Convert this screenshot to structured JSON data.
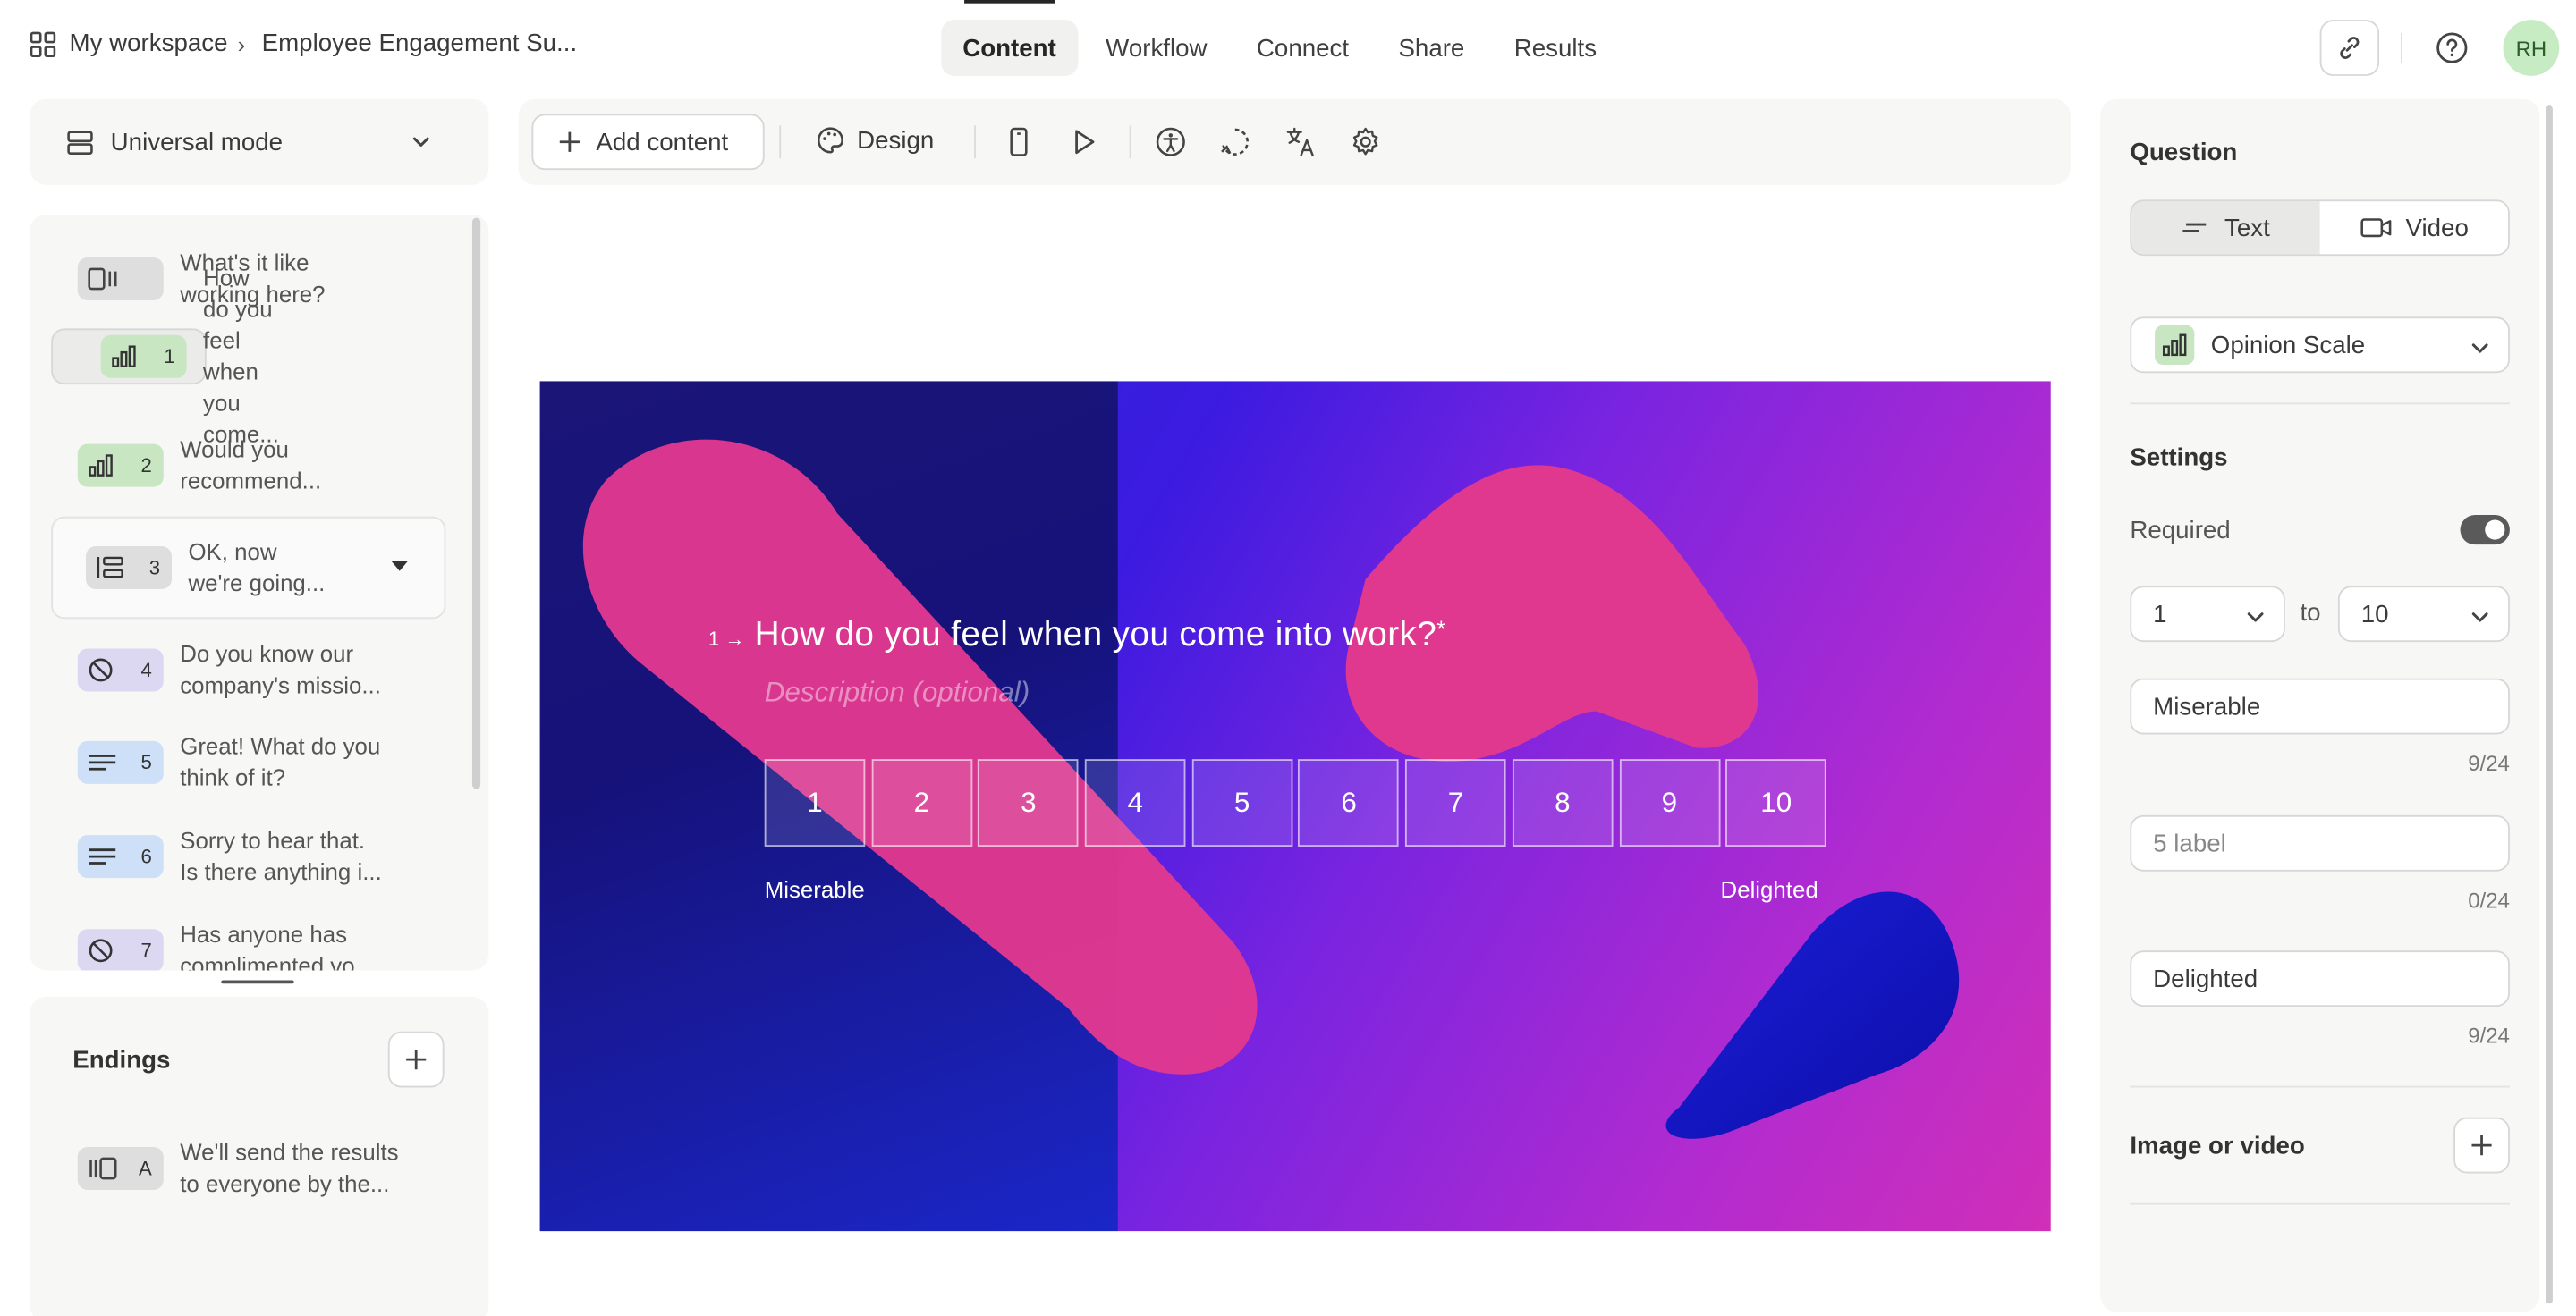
{
  "breadcrumb": {
    "workspace": "My workspace",
    "form": "Employee Engagement Su..."
  },
  "nav": {
    "tabs": [
      "Content",
      "Workflow",
      "Connect",
      "Share",
      "Results"
    ],
    "active": "Content"
  },
  "user": {
    "initials": "RH"
  },
  "mode": {
    "label": "Universal mode"
  },
  "questions": [
    {
      "num": "",
      "line1": "What's it like",
      "line2": "working here?"
    },
    {
      "num": "1",
      "line1": "How do you feel",
      "line2": "when you come..."
    },
    {
      "num": "2",
      "line1": "Would you",
      "line2": "recommend..."
    },
    {
      "num": "3",
      "line1": "OK, now",
      "line2": "we're going..."
    },
    {
      "num": "4",
      "line1": "Do you know our",
      "line2": "company's missio..."
    },
    {
      "num": "5",
      "line1": "Great! What do you",
      "line2": "think of it?"
    },
    {
      "num": "6",
      "line1": "Sorry to hear that.",
      "line2": "Is there anything i..."
    },
    {
      "num": "7",
      "line1": "Has anyone has",
      "line2": "complimented yo..."
    }
  ],
  "endings": {
    "title": "Endings",
    "items": [
      {
        "letter": "A",
        "line1": "We'll send the results",
        "line2": "to everyone by the..."
      }
    ]
  },
  "toolbar": {
    "add_content": "Add content",
    "design": "Design"
  },
  "preview": {
    "question_number": "1",
    "question_title": "How do you feel when you come into work?",
    "required_mark": "*",
    "description_placeholder": "Description (optional)",
    "scale": [
      "1",
      "2",
      "3",
      "4",
      "5",
      "6",
      "7",
      "8",
      "9",
      "10"
    ],
    "left_label": "Miserable",
    "right_label": "Delighted"
  },
  "settings_panel": {
    "question_title": "Question",
    "text_tab": "Text",
    "video_tab": "Video",
    "question_type": "Opinion Scale",
    "settings_title": "Settings",
    "required_label": "Required",
    "required_on": true,
    "range_from": "1",
    "range_to_word": "to",
    "range_to": "10",
    "label_left": "Miserable",
    "label_left_count": "9/24",
    "label_mid_placeholder": "5 label",
    "label_mid_count": "0/24",
    "label_right": "Delighted",
    "label_right_count": "9/24",
    "image_video": "Image or video"
  }
}
